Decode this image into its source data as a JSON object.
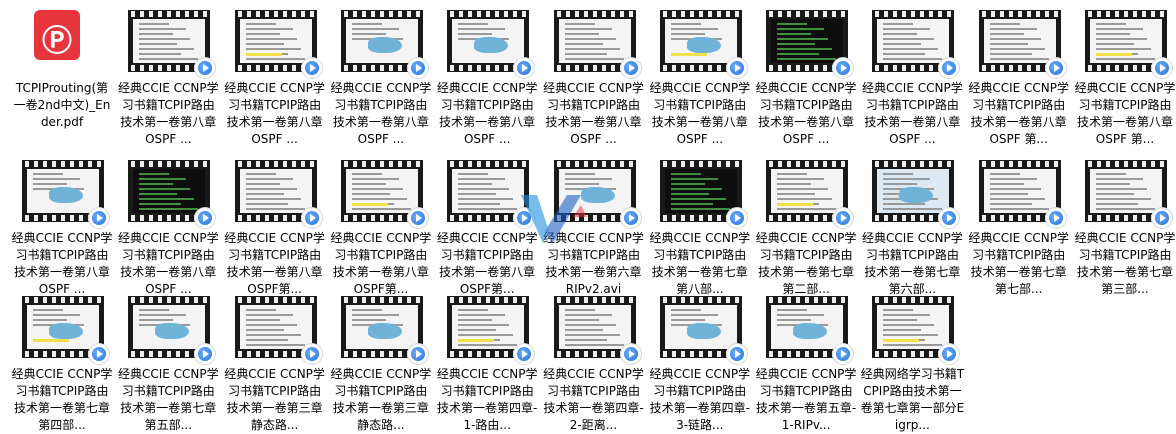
{
  "colors": {
    "accent": "#1f6fdc",
    "pdf": "#e8353c",
    "film": "#1a1a1a"
  },
  "files": [
    {
      "kind": "pdf",
      "icon": "pdf-icon",
      "label": "TCPIProuting(第一卷2nd中文)_Ender.pdf"
    },
    {
      "kind": "video",
      "style": "doc",
      "label": "经典CCIE CCNP学习书籍TCPIP路由技术第一卷第八章OSPF ..."
    },
    {
      "kind": "video",
      "style": "doc",
      "label": "经典CCIE CCNP学习书籍TCPIP路由技术第一卷第八章OSPF ..."
    },
    {
      "kind": "video",
      "style": "net",
      "label": "经典CCIE CCNP学习书籍TCPIP路由技术第一卷第八章OSPF ..."
    },
    {
      "kind": "video",
      "style": "net",
      "label": "经典CCIE CCNP学习书籍TCPIP路由技术第一卷第八章OSPF ..."
    },
    {
      "kind": "video",
      "style": "doc",
      "label": "经典CCIE CCNP学习书籍TCPIP路由技术第一卷第八章OSPF ..."
    },
    {
      "kind": "video",
      "style": "net",
      "label": "经典CCIE CCNP学习书籍TCPIP路由技术第一卷第八章OSPF ..."
    },
    {
      "kind": "video",
      "style": "dark",
      "label": "经典CCIE CCNP学习书籍TCPIP路由技术第一卷第八章OSPF ..."
    },
    {
      "kind": "video",
      "style": "doc",
      "label": "经典CCIE CCNP学习书籍TCPIP路由技术第一卷第八章OSPF ..."
    },
    {
      "kind": "video",
      "style": "doc",
      "label": "经典CCIE CCNP学习书籍TCPIP路由技术第一卷第八章OSPF 第..."
    },
    {
      "kind": "video",
      "style": "doc",
      "label": "经典CCIE CCNP学习书籍TCPIP路由技术第一卷第八章OSPF 第..."
    },
    {
      "kind": "video",
      "style": "net",
      "label": "经典CCIE CCNP学习书籍TCPIP路由技术第一卷第八章OSPF ..."
    },
    {
      "kind": "video",
      "style": "dark",
      "label": "经典CCIE CCNP学习书籍TCPIP路由技术第一卷第八章OSPF ..."
    },
    {
      "kind": "video",
      "style": "doc",
      "label": "经典CCIE CCNP学习书籍TCPIP路由技术第一卷第八章OSPF第..."
    },
    {
      "kind": "video",
      "style": "doc",
      "label": "经典CCIE CCNP学习书籍TCPIP路由技术第一卷第八章OSPF第..."
    },
    {
      "kind": "video",
      "style": "doc",
      "label": "经典CCIE CCNP学习书籍TCPIP路由技术第一卷第八章OSPF第..."
    },
    {
      "kind": "video",
      "style": "net",
      "label": "经典CCIE CCNP学习书籍TCPIP路由技术第一卷第六章 RIPv2.avi"
    },
    {
      "kind": "video",
      "style": "dark",
      "label": "经典CCIE CCNP学习书籍TCPIP路由技术第一卷第七章第八部..."
    },
    {
      "kind": "video",
      "style": "doc",
      "label": "经典CCIE CCNP学习书籍TCPIP路由技术第一卷第七章第二部..."
    },
    {
      "kind": "video",
      "style": "lightblue",
      "label": "经典CCIE CCNP学习书籍TCPIP路由技术第一卷第七章第六部..."
    },
    {
      "kind": "video",
      "style": "doc",
      "label": "经典CCIE CCNP学习书籍TCPIP路由技术第一卷第七章第七部..."
    },
    {
      "kind": "video",
      "style": "doc",
      "label": "经典CCIE CCNP学习书籍TCPIP路由技术第一卷第七章第三部..."
    },
    {
      "kind": "video",
      "style": "net",
      "label": "经典CCIE CCNP学习书籍TCPIP路由技术第一卷第七章第四部..."
    },
    {
      "kind": "video",
      "style": "net",
      "label": "经典CCIE CCNP学习书籍TCPIP路由技术第一卷第七章第五部..."
    },
    {
      "kind": "video",
      "style": "doc",
      "label": "经典CCIE CCNP学习书籍TCPIP路由技术第一卷第三章静态路..."
    },
    {
      "kind": "video",
      "style": "net",
      "label": "经典CCIE CCNP学习书籍TCPIP路由技术第一卷第三章静态路..."
    },
    {
      "kind": "video",
      "style": "doc",
      "label": "经典CCIE CCNP学习书籍TCPIP路由技术第一卷第四章-1-路由..."
    },
    {
      "kind": "video",
      "style": "doc",
      "label": "经典CCIE CCNP学习书籍TCPIP路由技术第一卷第四章-2-距离..."
    },
    {
      "kind": "video",
      "style": "net",
      "label": "经典CCIE CCNP学习书籍TCPIP路由技术第一卷第四章-3-链路..."
    },
    {
      "kind": "video",
      "style": "net",
      "label": "经典CCIE CCNP学习书籍TCPIP路由技术第一卷第五章-1-RIPv..."
    },
    {
      "kind": "video",
      "style": "doc",
      "label": "经典网络学习书籍TCPIP路由技术第一卷第七章第一部分Eigrp..."
    }
  ]
}
